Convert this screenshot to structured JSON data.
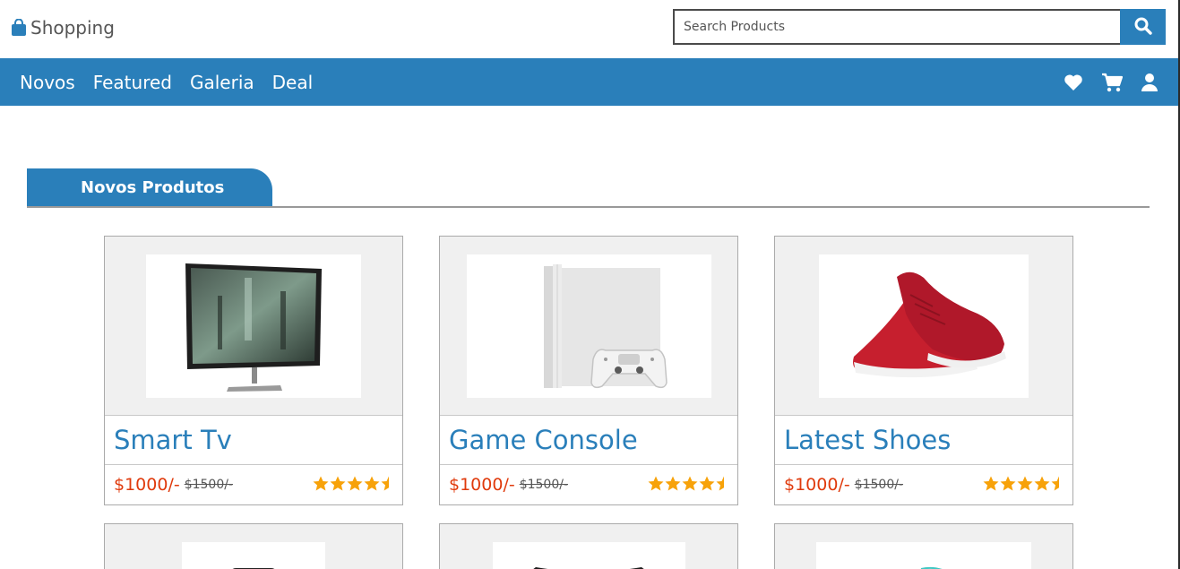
{
  "header": {
    "brand_label": "Shopping",
    "search_placeholder": "Search Products"
  },
  "nav": {
    "links": [
      "Novos",
      "Featured",
      "Galeria",
      "Deal"
    ]
  },
  "section": {
    "title": "Novos Produtos"
  },
  "products": [
    {
      "title": "Smart Tv",
      "price": "$1000/-",
      "old_price": "$1500/-",
      "rating": 4.5
    },
    {
      "title": "Game Console",
      "price": "$1000/-",
      "old_price": "$1500/-",
      "rating": 4.5
    },
    {
      "title": "Latest Shoes",
      "price": "$1000/-",
      "old_price": "$1500/-",
      "rating": 4.5
    }
  ],
  "colors": {
    "primary": "#2a7fba",
    "price": "#e03a0c",
    "star": "#f7a20a"
  }
}
